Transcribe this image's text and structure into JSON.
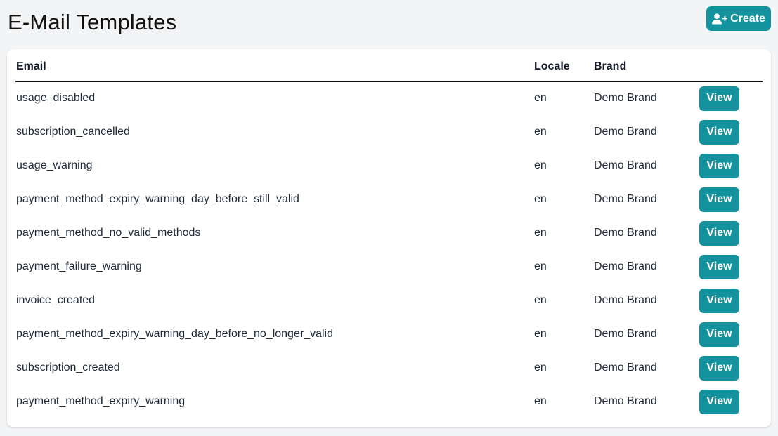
{
  "page": {
    "title": "E-Mail Templates",
    "create_label": "Create",
    "create_icon": "user-plus-icon",
    "accent_color": "#14939f"
  },
  "table": {
    "columns": [
      "Email",
      "Locale",
      "Brand",
      ""
    ],
    "rows": [
      {
        "email": "usage_disabled",
        "locale": "en",
        "brand": "Demo Brand",
        "action": "View"
      },
      {
        "email": "subscription_cancelled",
        "locale": "en",
        "brand": "Demo Brand",
        "action": "View"
      },
      {
        "email": "usage_warning",
        "locale": "en",
        "brand": "Demo Brand",
        "action": "View"
      },
      {
        "email": "payment_method_expiry_warning_day_before_still_valid",
        "locale": "en",
        "brand": "Demo Brand",
        "action": "View"
      },
      {
        "email": "payment_method_no_valid_methods",
        "locale": "en",
        "brand": "Demo Brand",
        "action": "View"
      },
      {
        "email": "payment_failure_warning",
        "locale": "en",
        "brand": "Demo Brand",
        "action": "View"
      },
      {
        "email": "invoice_created",
        "locale": "en",
        "brand": "Demo Brand",
        "action": "View"
      },
      {
        "email": "payment_method_expiry_warning_day_before_no_longer_valid",
        "locale": "en",
        "brand": "Demo Brand",
        "action": "View"
      },
      {
        "email": "subscription_created",
        "locale": "en",
        "brand": "Demo Brand",
        "action": "View"
      },
      {
        "email": "payment_method_expiry_warning",
        "locale": "en",
        "brand": "Demo Brand",
        "action": "View"
      }
    ]
  }
}
